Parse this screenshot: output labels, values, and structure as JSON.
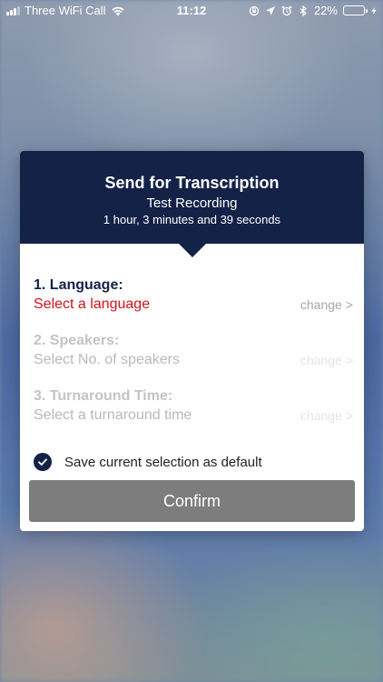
{
  "status_bar": {
    "carrier": "Three WiFi Call",
    "time": "11:12",
    "battery_percent": "22%",
    "battery_level": 0.22
  },
  "dialog": {
    "title": "Send for Transcription",
    "recording_name": "Test Recording",
    "duration": "1 hour, 3 minutes and 39 seconds",
    "options": [
      {
        "title": "1. Language:",
        "value": "Select a language",
        "action": "change",
        "enabled": true
      },
      {
        "title": "2. Speakers:",
        "value": "Select No. of speakers",
        "action": "change",
        "enabled": false
      },
      {
        "title": "3. Turnaround Time:",
        "value": "Select a turnaround time",
        "action": "change",
        "enabled": false
      }
    ],
    "save_default_label": "Save current selection as default",
    "save_default_checked": true,
    "confirm_label": "Confirm"
  },
  "colors": {
    "header_bg": "#142247",
    "accent_red": "#d0121b",
    "button_disabled": "#7d7d7d"
  }
}
